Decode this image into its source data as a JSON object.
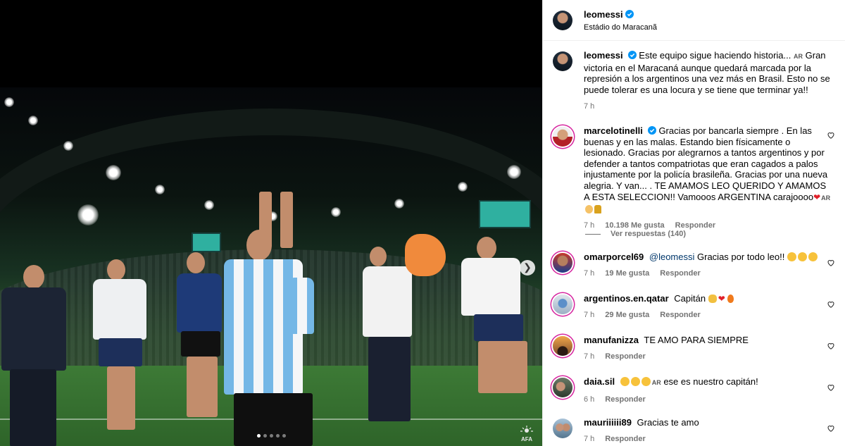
{
  "post": {
    "author": "leomessi",
    "location": "Estádio do Maracanã",
    "carousel": {
      "slide_count": 5,
      "active_slide": 1
    },
    "media_logo_text": "AFA"
  },
  "caption": {
    "author": "leomessi",
    "text_line1": "Este equipo sigue haciendo historia...",
    "translate_tag": "AR",
    "text_body": "Gran victoria en el Maracaná aunque quedará marcada por la represión a los argentinos una vez más en Brasil. Esto no se puede tolerar es una locura y se tiene que terminar ya!!",
    "time": "7 h"
  },
  "comments": [
    {
      "author": "marcelotinelli",
      "verified": true,
      "text": "Gracias por bancarla siempre . En las buenas y en las malas. Estando bien físicamente o lesionado. Gracias por alegrarnos a tantos argentinos y por defender a tantos compatriotas que eran cagados a palos injustamente por la policía brasileña. Gracias por una nueva alegria. Y van... . TE AMAMOS LEO QUERIDO Y AMAMOS A ESTA SELECCION!! Vamooos ARGENTINA carajoooo",
      "emoji_tag": "AR",
      "time": "7 h",
      "likes": "10.198 Me gusta",
      "reply": "Responder",
      "view_replies": "Ver respuestas (140)"
    },
    {
      "author": "omarporcel69",
      "mention": "@leomessi",
      "text": "Gracias por todo leo!!",
      "time": "7 h",
      "likes": "19 Me gusta",
      "reply": "Responder"
    },
    {
      "author": "argentinos.en.qatar",
      "text": "Capitán",
      "time": "7 h",
      "likes": "29 Me gusta",
      "reply": "Responder"
    },
    {
      "author": "manufanizza",
      "text": "TE AMO PARA SIEMPRE",
      "time": "7 h",
      "reply": "Responder"
    },
    {
      "author": "daia.sil",
      "emoji_tag": "AR",
      "text": "ese es nuestro capitán!",
      "time": "6 h",
      "reply": "Responder"
    },
    {
      "author": "mauriiiiii89",
      "text": "Gracias te amo",
      "time": "7 h",
      "reply": "Responder"
    }
  ],
  "colors": {
    "verified_blue": "#0095f6",
    "meta_gray": "#737373",
    "story_ring": "#d6249f"
  },
  "icons": [
    "verified-badge-icon",
    "heart-icon",
    "chevron-right-icon",
    "clap-emoji-icon",
    "red-heart-emoji-icon"
  ]
}
